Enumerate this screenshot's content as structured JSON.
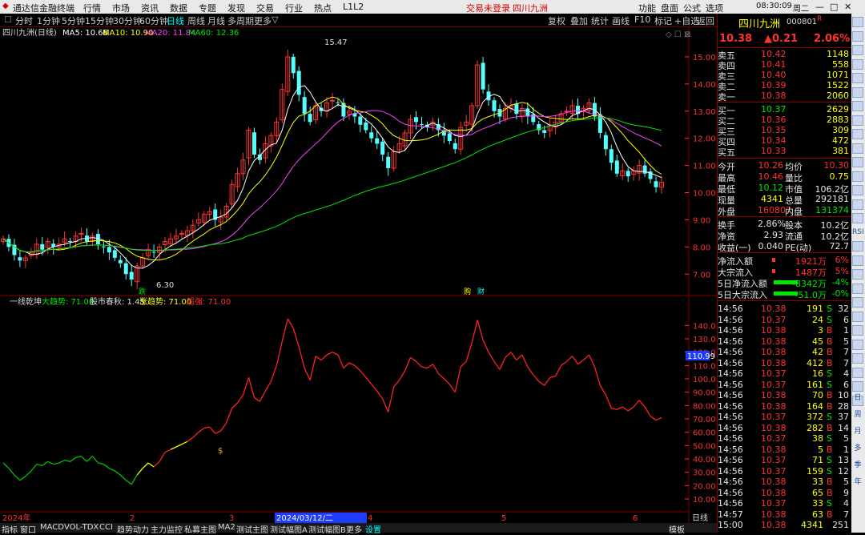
{
  "app": {
    "title": "通达信金融终端",
    "menus": [
      "行情",
      "市场",
      "资讯",
      "数据",
      "专题",
      "发现",
      "交易",
      "行业",
      "热点",
      "L1L2"
    ],
    "status": "交易未登录",
    "stock_tab": "四川九洲",
    "right_menus": [
      "功能",
      "盘面",
      "公式",
      "选项"
    ],
    "time": "08:30:09",
    "weekday": "周二"
  },
  "period": {
    "items": [
      "分时",
      "1分钟",
      "5分钟",
      "15分钟",
      "30分钟",
      "60分钟",
      "日线",
      "周线",
      "月线",
      "多周期",
      "更多"
    ],
    "active": "日线",
    "chevron": "▽"
  },
  "tools": {
    "items": [
      "复权",
      "叠加",
      "统计",
      "画线",
      "F10",
      "标记",
      "+自选",
      "返回"
    ]
  },
  "chart": {
    "label": "四川九洲(日线)",
    "ma5": "MA5: 10.66",
    "ma10": "MA10: 10.90",
    "ma20": "MA20: 11.84",
    "ma60": "MA60: 12.36",
    "colors": {
      "ma5": "#ffffff",
      "ma10": "#ffff00",
      "ma20": "#ff40ff",
      "ma60": "#00e600",
      "up": "#ff3232",
      "down": "#54ffff"
    },
    "price_ticks": [
      "15.00",
      "14.00",
      "13.00",
      "12.00",
      "11.00",
      "10.00",
      "9.00",
      "8.00",
      "7.00"
    ],
    "high_label": "15.47",
    "low_label": "6.30",
    "markers": {
      "buy": "跌",
      "b1": "购",
      "b2": "财"
    },
    "indicator_header": {
      "name": "一线乾坤",
      "i1": "大趋势: 71.00",
      "i2": "股市春秋: 1.45",
      "i3": "涨趋势: 71.00",
      "i4": "超强: 71.00"
    },
    "ind_ticks": [
      "140.0",
      "130.0",
      "120.0",
      "110.0",
      "100.0",
      "90.00",
      "80.00",
      "70.00",
      "60.00",
      "50.00",
      "40.00",
      "30.00",
      "20.00",
      "10.00"
    ],
    "ind_current": "110.99",
    "dates": [
      "2024年",
      "2",
      "3",
      "2024/03/12/二",
      "4",
      "5",
      "6"
    ],
    "axis_mode": "日线"
  },
  "chart_data": {
    "type": "line",
    "title": "四川九洲(日线)",
    "xlabel": "",
    "ylabel": "",
    "price_range": [
      6.3,
      15.47
    ],
    "indicator_range": [
      10,
      145
    ],
    "indicator_series": [
      {
        "name": "一线乾坤",
        "values": [
          37,
          33,
          28,
          24,
          27,
          31,
          36,
          35,
          38,
          36,
          37,
          39,
          38,
          41,
          42,
          38,
          42,
          37,
          36,
          33,
          31,
          28,
          24,
          21,
          28,
          33,
          37,
          34,
          38,
          45,
          47,
          49,
          51,
          53,
          56,
          60,
          63,
          64,
          59,
          61,
          67,
          78,
          82,
          88,
          101,
          86,
          83,
          91,
          98,
          110,
          128,
          145,
          138,
          124,
          108,
          99,
          117,
          114,
          118,
          120,
          118,
          108,
          112,
          110,
          106,
          101,
          96,
          91,
          85,
          75,
          94,
          99,
          106,
          116,
          113,
          109,
          108,
          111,
          104,
          100,
          96,
          90,
          109,
          113,
          127,
          144,
          129,
          120,
          113,
          107,
          116,
          120,
          114,
          118,
          109,
          103,
          98,
          95,
          101,
          102,
          110,
          113,
          117,
          111,
          114,
          118,
          109,
          95,
          88,
          78,
          77,
          79,
          76,
          79,
          84,
          79,
          72,
          69,
          71
        ]
      }
    ],
    "price_series": [
      {
        "name": "close",
        "values": [
          8.3,
          8.0,
          7.7,
          7.5,
          7.6,
          7.8,
          8.1,
          7.9,
          8.2,
          8.0,
          8.1,
          8.3,
          8.2,
          8.4,
          8.5,
          8.2,
          8.4,
          8.1,
          8.0,
          7.8,
          7.6,
          7.4,
          7.0,
          6.8,
          7.3,
          7.6,
          7.9,
          7.8,
          8.0,
          8.2,
          8.3,
          8.4,
          8.5,
          8.6,
          8.8,
          9.0,
          9.2,
          9.3,
          9.0,
          9.1,
          9.5,
          10.3,
          10.7,
          11.2,
          12.3,
          11.4,
          11.2,
          11.8,
          12.1,
          12.6,
          13.8,
          15.0,
          14.4,
          13.6,
          12.9,
          12.6,
          13.2,
          13.0,
          13.3,
          13.4,
          13.3,
          12.8,
          13.0,
          12.8,
          12.5,
          12.3,
          12.0,
          11.8,
          11.4,
          10.9,
          11.5,
          11.8,
          12.2,
          12.7,
          12.6,
          12.5,
          12.4,
          12.6,
          12.3,
          12.1,
          11.9,
          11.6,
          12.4,
          12.6,
          13.2,
          14.7,
          13.8,
          13.4,
          13.0,
          12.8,
          13.1,
          13.2,
          12.9,
          13.1,
          12.8,
          12.6,
          12.3,
          12.2,
          12.5,
          12.6,
          12.9,
          13.0,
          13.2,
          12.9,
          13.1,
          13.3,
          12.8,
          12.2,
          11.6,
          11.1,
          10.7,
          10.8,
          10.6,
          10.8,
          11.0,
          10.7,
          10.5,
          10.2,
          10.38
        ]
      }
    ]
  },
  "quote": {
    "name": "四川九洲",
    "code": "000801",
    "flag": "R",
    "price": "10.38",
    "change": "▲0.21",
    "pct": "2.06%",
    "asks": [
      {
        "l": "卖五",
        "p": "10.42",
        "v": "1148"
      },
      {
        "l": "卖四",
        "p": "10.41",
        "v": "558"
      },
      {
        "l": "卖三",
        "p": "10.40",
        "v": "1071"
      },
      {
        "l": "卖二",
        "p": "10.39",
        "v": "1522"
      },
      {
        "l": "卖一",
        "p": "10.38",
        "v": "2060"
      }
    ],
    "bids": [
      {
        "l": "买一",
        "p": "10.37",
        "v": "2629"
      },
      {
        "l": "买二",
        "p": "10.36",
        "v": "2883"
      },
      {
        "l": "买三",
        "p": "10.35",
        "v": "309"
      },
      {
        "l": "买四",
        "p": "10.34",
        "v": "472"
      },
      {
        "l": "买五",
        "p": "10.33",
        "v": "381"
      }
    ],
    "stats": [
      {
        "l1": "今开",
        "v1": "10.26",
        "l2": "均价",
        "v2": "10.30",
        "c1": "red",
        "c2": "red"
      },
      {
        "l1": "最高",
        "v1": "10.46",
        "l2": "量比",
        "v2": "0.75",
        "c1": "red",
        "c2": "yellow"
      },
      {
        "l1": "最低",
        "v1": "10.12",
        "l2": "市值",
        "v2": "106.2亿",
        "c1": "green",
        "c2": "white"
      },
      {
        "l1": "现量",
        "v1": "4341",
        "l2": "总量",
        "v2": "292181",
        "c1": "yellow",
        "c2": "white"
      },
      {
        "l1": "外盘",
        "v1": "160807",
        "l2": "内盘",
        "v2": "131374",
        "c1": "red",
        "c2": "green"
      }
    ],
    "stats2": [
      {
        "l1": "换手",
        "v1": "2.86%",
        "l2": "股本",
        "v2": "10.2亿"
      },
      {
        "l1": "净资",
        "v1": "2.93",
        "l2": "流通",
        "v2": "10.2亿"
      },
      {
        "l1": "收益(一)",
        "v1": "0.040",
        "l2": "PE(动)",
        "v2": "72.7"
      }
    ],
    "flows": [
      {
        "l": "净流入额",
        "v": "1921万",
        "p": "6%",
        "c": "red"
      },
      {
        "l": "大宗流入",
        "v": "1487万",
        "p": "5%",
        "c": "red"
      },
      {
        "l": "5日净流入额",
        "v": "-8342万",
        "p": "-4%",
        "c": "green"
      },
      {
        "l": "5日大宗流入",
        "v": "-51.0万",
        "p": "-0%",
        "c": "green"
      }
    ],
    "ticks": [
      [
        "14:56",
        "10.38",
        "191",
        "S",
        "32"
      ],
      [
        "14:56",
        "10.37",
        "24",
        "S",
        "6"
      ],
      [
        "14:56",
        "10.38",
        "3",
        "B",
        "1"
      ],
      [
        "14:56",
        "10.38",
        "45",
        "B",
        "5"
      ],
      [
        "14:56",
        "10.38",
        "42",
        "B",
        "7"
      ],
      [
        "14:56",
        "10.38",
        "412",
        "B",
        "7"
      ],
      [
        "14:56",
        "10.37",
        "16",
        "S",
        "4"
      ],
      [
        "14:56",
        "10.37",
        "161",
        "S",
        "6"
      ],
      [
        "14:56",
        "10.38",
        "70",
        "B",
        "10"
      ],
      [
        "14:56",
        "10.38",
        "164",
        "B",
        "28"
      ],
      [
        "14:56",
        "10.37",
        "372",
        "S",
        "37"
      ],
      [
        "14:56",
        "10.38",
        "282",
        "B",
        "14"
      ],
      [
        "14:56",
        "10.37",
        "38",
        "S",
        "5"
      ],
      [
        "14:56",
        "10.38",
        "5",
        "B",
        "1"
      ],
      [
        "14:56",
        "10.37",
        "71",
        "S",
        "13"
      ],
      [
        "14:56",
        "10.37",
        "159",
        "S",
        "12"
      ],
      [
        "14:56",
        "10.38",
        "33",
        "B",
        "5"
      ],
      [
        "14:56",
        "10.38",
        "65",
        "B",
        "9"
      ],
      [
        "14:56",
        "10.37",
        "33",
        "S",
        "4"
      ],
      [
        "14:57",
        "10.38",
        "63",
        "B",
        "7"
      ],
      [
        "15:00",
        "10.38",
        "4341",
        "",
        "251"
      ]
    ]
  },
  "bottom": {
    "items": [
      "指标",
      "窗口",
      "MACD",
      "VOL-TDX",
      "CCI",
      "趋势动力",
      "主力监控",
      "私募主图",
      "MA2",
      "测试主图",
      "测试幅图A",
      "测试幅图B",
      "更多",
      "设置"
    ],
    "right": "模板",
    "right2": "日线"
  },
  "sidebar": {
    "items": [
      "",
      "",
      "",
      "",
      "",
      "",
      "",
      "",
      "",
      "",
      "",
      "",
      "",
      "",
      "",
      "RSI",
      "",
      "",
      "",
      "",
      "",
      "",
      "",
      "",
      "",
      "",
      "",
      "",
      "日",
      "周",
      "月",
      "多",
      "季",
      "年"
    ]
  }
}
